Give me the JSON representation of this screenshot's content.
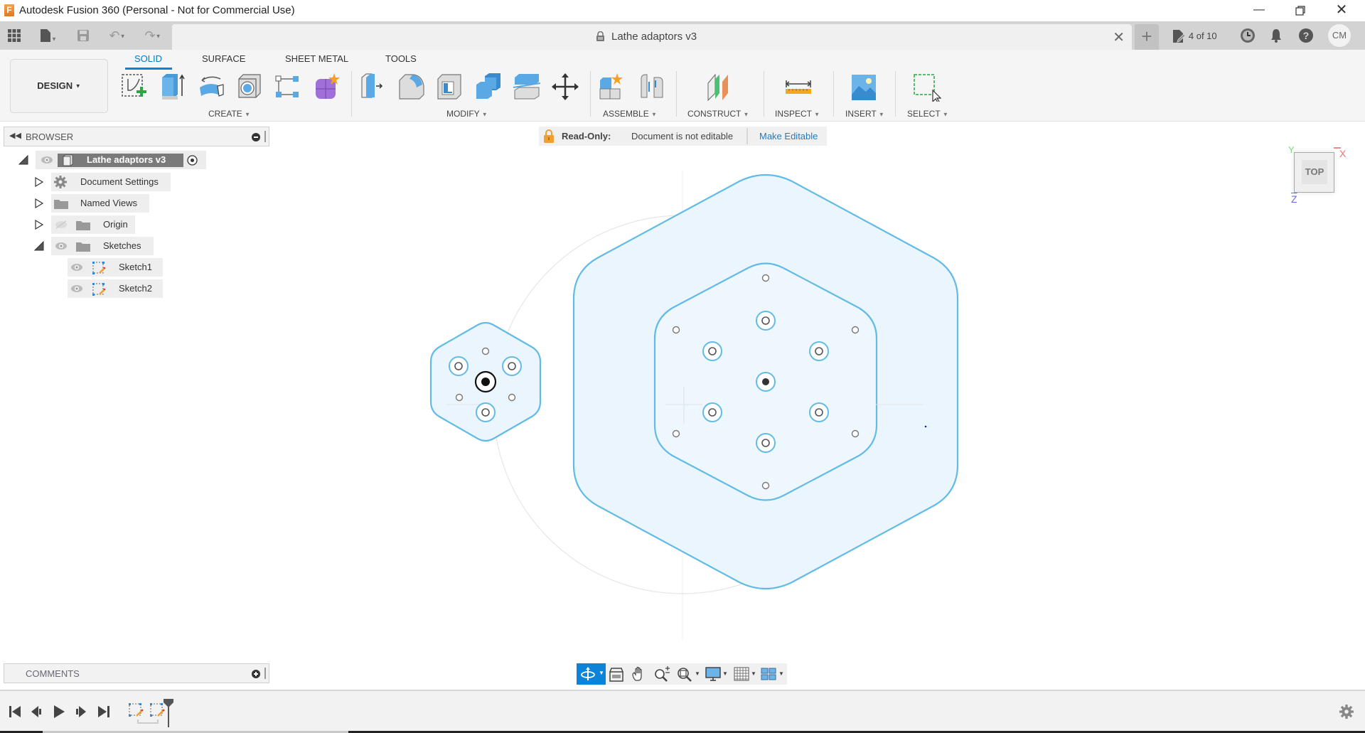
{
  "window": {
    "app_title": "Autodesk Fusion 360 (Personal - Not for Commercial Use)",
    "app_icon_letter": "F",
    "minimize_icon": "minimize-icon",
    "restore_icon": "restore-icon",
    "close_icon": "close-icon"
  },
  "tabbar": {
    "document_title": "Lathe adaptors v3",
    "document_locked": true,
    "job_status": "4 of 10",
    "user_initials": "CM",
    "icons": [
      "data-panel-grid-icon",
      "file-icon",
      "save-icon",
      "undo-icon",
      "redo-icon",
      "close-tab-icon",
      "new-tab-plus-icon",
      "job-status-icon",
      "history-clock-icon",
      "notification-bell-icon",
      "help-icon"
    ]
  },
  "toolbar": {
    "workspace": "DESIGN",
    "ribbon_tabs": [
      {
        "label": "SOLID",
        "active": true
      },
      {
        "label": "SURFACE",
        "active": false
      },
      {
        "label": "SHEET METAL",
        "active": false
      },
      {
        "label": "TOOLS",
        "active": false
      }
    ],
    "groups": {
      "create": "CREATE",
      "modify": "MODIFY",
      "assemble": "ASSEMBLE",
      "construct": "CONSTRUCT",
      "inspect": "INSPECT",
      "insert": "INSERT",
      "select": "SELECT"
    },
    "tools": {
      "create": [
        "create-sketch",
        "extrude",
        "revolve",
        "hole",
        "pattern",
        "create-form"
      ],
      "modify": [
        "press-pull",
        "fillet",
        "shell",
        "combine",
        "split-body",
        "move-copy"
      ],
      "assemble": [
        "new-component",
        "joint"
      ],
      "construct": [
        "offset-plane"
      ],
      "inspect": [
        "measure"
      ],
      "insert": [
        "insert-image"
      ],
      "select": [
        "window-select"
      ]
    }
  },
  "browser": {
    "title": "BROWSER",
    "items": [
      {
        "label": "Lathe adaptors v3",
        "level": 0,
        "expanded": true,
        "selected": true
      },
      {
        "label": "Document Settings",
        "level": 1,
        "expanded": false
      },
      {
        "label": "Named Views",
        "level": 1,
        "expanded": false
      },
      {
        "label": "Origin",
        "level": 1,
        "expanded": false,
        "hidden": true
      },
      {
        "label": "Sketches",
        "level": 1,
        "expanded": true
      },
      {
        "label": "Sketch1",
        "level": 2
      },
      {
        "label": "Sketch2",
        "level": 2
      }
    ]
  },
  "banner": {
    "label": "Read-Only:",
    "message": "Document is not editable",
    "action": "Make Editable"
  },
  "viewcube": {
    "face": "TOP",
    "axis_x": "X",
    "axis_y": "Y",
    "axis_z": "Z"
  },
  "comments": {
    "title": "COMMENTS"
  },
  "navbar": {
    "tools": [
      "orbit",
      "look-at",
      "pan",
      "zoom",
      "fit",
      "display-settings",
      "grid-snaps",
      "viewports"
    ]
  },
  "timeline": {
    "controls": [
      "go-to-start",
      "step-back",
      "play",
      "step-forward",
      "go-to-end"
    ],
    "features": [
      "Sketch1",
      "Sketch2"
    ]
  },
  "colors": {
    "accent": "#0a84d8",
    "sketch_profile": "#5bb8e4",
    "profile_fill": "#eaf5fd",
    "lock_orange": "#f0a030",
    "link": "#1f7bc4"
  }
}
